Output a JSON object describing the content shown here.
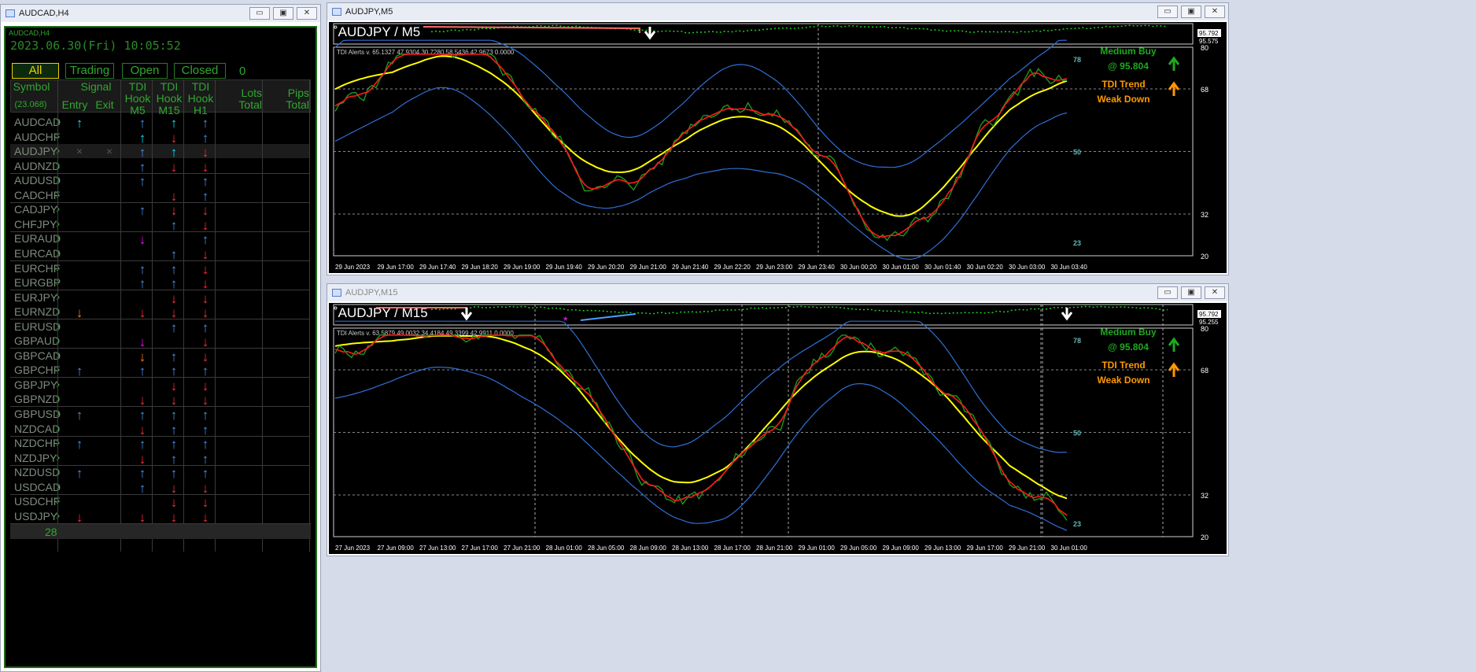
{
  "left_window": {
    "title": "AUDCAD,H4",
    "panel_symbol": "AUDCAD,H4",
    "datetime": "2023.06.30(Fri) 10:05:52",
    "tabs": [
      "All",
      "Trading",
      "Open",
      "Closed"
    ],
    "count": "0",
    "headers": {
      "symbol": "Symbol",
      "symbol_sub": "(23.068)",
      "signal": "Signal",
      "entry": "Entry",
      "exit": "Exit",
      "m5": "TDI\nHook\nM5",
      "m15": "TDI\nHook\nM15",
      "h1": "TDI\nHook\nH1",
      "lots": "Lots\nTotal",
      "pips": "Pips\nTotal"
    },
    "rows": [
      {
        "symbol": "AUDCAD",
        "entry": "up-cyan",
        "m5": "up-blue",
        "m15": "up-cyan",
        "h1": "up-blue"
      },
      {
        "symbol": "AUDCHF",
        "entry": "",
        "m5": "up-cyan",
        "m15": "down-red",
        "h1": "up-blue"
      },
      {
        "symbol": "AUDJPY",
        "entry": "x",
        "exit": "x",
        "m5": "up-blue",
        "m15": "up-cyan",
        "h1": "down-red",
        "highlight": true
      },
      {
        "symbol": "AUDNZD",
        "entry": "",
        "m5": "up-blue",
        "m15": "down-red",
        "h1": "down-red"
      },
      {
        "symbol": "AUDUSD",
        "entry": "",
        "m5": "up-blue",
        "m15": "",
        "h1": "up-blue"
      },
      {
        "symbol": "CADCHF",
        "entry": "",
        "m5": "",
        "m15": "down-red",
        "h1": "up-blue"
      },
      {
        "symbol": "CADJPY",
        "entry": "",
        "m5": "up-blue",
        "m15": "down-red",
        "h1": "down-red"
      },
      {
        "symbol": "CHFJPY",
        "entry": "",
        "m5": "",
        "m15": "up-blue",
        "h1": "down-red"
      },
      {
        "symbol": "EURAUD",
        "entry": "",
        "m5": "down-magenta",
        "m15": "",
        "h1": "up-blue"
      },
      {
        "symbol": "EURCAD",
        "entry": "",
        "m5": "",
        "m15": "up-blue",
        "h1": "down-red"
      },
      {
        "symbol": "EURCHF",
        "entry": "",
        "m5": "up-blue",
        "m15": "up-blue",
        "h1": "down-red"
      },
      {
        "symbol": "EURGBP",
        "entry": "",
        "m5": "up-blue",
        "m15": "up-blue",
        "h1": "down-red"
      },
      {
        "symbol": "EURJPY",
        "entry": "",
        "m5": "",
        "m15": "down-red",
        "h1": "down-red"
      },
      {
        "symbol": "EURNZD",
        "entry": "down-orange",
        "m5": "down-red",
        "m15": "down-red",
        "h1": "down-red"
      },
      {
        "symbol": "EURUSD",
        "entry": "",
        "m5": "",
        "m15": "up-blue",
        "h1": "up-blue"
      },
      {
        "symbol": "GBPAUD",
        "entry": "",
        "m5": "down-magenta",
        "m15": "",
        "h1": "down-red"
      },
      {
        "symbol": "GBPCAD",
        "entry": "",
        "m5": "down-orange",
        "m15": "up-blue",
        "h1": "down-red"
      },
      {
        "symbol": "GBPCHF",
        "entry": "up-blue",
        "m5": "up-blue",
        "m15": "up-blue",
        "h1": "up-blue"
      },
      {
        "symbol": "GBPJPY",
        "entry": "",
        "m5": "",
        "m15": "down-red",
        "h1": "down-red"
      },
      {
        "symbol": "GBPNZD",
        "entry": "",
        "m5": "down-red",
        "m15": "down-red",
        "h1": "down-red"
      },
      {
        "symbol": "GBPUSD",
        "entry": "up-blue",
        "m5": "up-blue",
        "m15": "up-blue",
        "h1": "up-blue"
      },
      {
        "symbol": "NZDCAD",
        "entry": "",
        "m5": "down-red",
        "m15": "up-blue",
        "h1": "up-blue"
      },
      {
        "symbol": "NZDCHF",
        "entry": "up-blue",
        "m5": "up-blue",
        "m15": "up-blue",
        "h1": "up-blue"
      },
      {
        "symbol": "NZDJPY",
        "entry": "",
        "m5": "down-red",
        "m15": "up-blue",
        "h1": "up-blue"
      },
      {
        "symbol": "NZDUSD",
        "entry": "up-blue",
        "m5": "up-blue",
        "m15": "up-blue",
        "h1": "up-blue"
      },
      {
        "symbol": "USDCAD",
        "entry": "",
        "m5": "up-blue",
        "m15": "down-red",
        "h1": "down-red"
      },
      {
        "symbol": "USDCHF",
        "entry": "",
        "m5": "",
        "m15": "down-red",
        "h1": "down-red"
      },
      {
        "symbol": "USDJPY",
        "entry": "down-red",
        "m5": "down-red",
        "m15": "down-red",
        "h1": "down-red"
      }
    ],
    "total": "28"
  },
  "charts": [
    {
      "title": "AUDJPY,M5",
      "symbol_label": "AUDJPY / M5",
      "indicator_label": "TDI Alerts v. 65.1327 47.9304 30.7280 58.5436 42.9673 0.0000",
      "price_top": "95.792",
      "price_bottom": "95.575",
      "levels": {
        "l78": "78",
        "l50": "50",
        "l23": "23"
      },
      "right_axis": [
        "80",
        "68",
        "32",
        "20"
      ],
      "signal_text": {
        "l1": "Medium Buy",
        "l2": "@ 95.804",
        "l3": "TDI Trend",
        "l4": "Weak Down"
      },
      "time_labels": [
        "29 Jun 2023",
        "29 Jun 17:00",
        "29 Jun 17:40",
        "29 Jun 18:20",
        "29 Jun 19:00",
        "29 Jun 19:40",
        "29 Jun 20:20",
        "29 Jun 21:00",
        "29 Jun 21:40",
        "29 Jun 22:20",
        "29 Jun 23:00",
        "29 Jun 23:40",
        "30 Jun 00:20",
        "30 Jun 01:00",
        "30 Jun 01:40",
        "30 Jun 02:20",
        "30 Jun 03:00",
        "30 Jun 03:40"
      ]
    },
    {
      "title": "AUDJPY,M15",
      "symbol_label": "AUDJPY / M15",
      "indicator_label": "TDI Alerts v. 63.5879 49.0032 34.4184 49.3399 42.9911 0.0000",
      "price_top": "95.792",
      "price_bottom": "95.255",
      "levels": {
        "l78": "78",
        "l50": "50",
        "l23": "23"
      },
      "right_axis": [
        "80",
        "68",
        "32",
        "20"
      ],
      "signal_text": {
        "l1": "Medium Buy",
        "l2": "@ 95.804",
        "l3": "TDI Trend",
        "l4": "Weak Down"
      },
      "time_labels": [
        "27 Jun 2023",
        "27 Jun 09:00",
        "27 Jun 13:00",
        "27 Jun 17:00",
        "27 Jun 21:00",
        "28 Jun 01:00",
        "28 Jun 05:00",
        "28 Jun 09:00",
        "28 Jun 13:00",
        "28 Jun 17:00",
        "28 Jun 21:00",
        "29 Jun 01:00",
        "29 Jun 05:00",
        "29 Jun 09:00",
        "29 Jun 13:00",
        "29 Jun 17:00",
        "29 Jun 21:00",
        "30 Jun 01:00"
      ]
    }
  ],
  "colors": {
    "up-blue": "#4a90e2",
    "up-cyan": "#00e5ff",
    "down-red": "#ff2a3c",
    "down-magenta": "#ff00ff",
    "down-orange": "#ff7a1a",
    "green": "#2fa82f",
    "yellow": "#ffff00",
    "signal_green": "#1fa81f",
    "signal_orange": "#ff9900"
  },
  "icons": {
    "minimize": "minimize-icon",
    "maximize": "maximize-icon",
    "close": "close-icon"
  }
}
